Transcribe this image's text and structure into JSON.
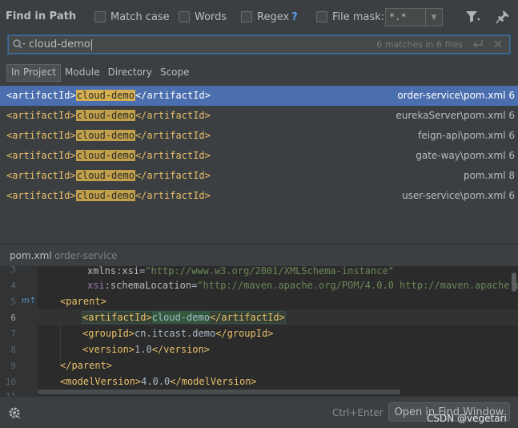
{
  "header": {
    "title": "Find in Path",
    "match_case_label": "Match case",
    "words_label": "Words",
    "regex_label": "Regex",
    "regex_help": "?",
    "file_mask_label": "File mask:",
    "file_mask_value": "*.*"
  },
  "search": {
    "query": "cloud-demo",
    "matches": "6 matches in 6 files"
  },
  "scopes": [
    "In Project",
    "Module",
    "Directory",
    "Scope"
  ],
  "results": [
    {
      "open": "<artifactId>",
      "match": "cloud-demo",
      "close": "</artifactId>",
      "path": "order-service\\pom.xml 6"
    },
    {
      "open": "<artifactId>",
      "match": "cloud-demo",
      "close": "</artifactId>",
      "path": "eurekaServer\\pom.xml 6"
    },
    {
      "open": "<artifactId>",
      "match": "cloud-demo",
      "close": "</artifactId>",
      "path": "feign-api\\pom.xml 6"
    },
    {
      "open": "<artifactId>",
      "match": "cloud-demo",
      "close": "</artifactId>",
      "path": "gate-way\\pom.xml 6"
    },
    {
      "open": "<artifactId>",
      "match": "cloud-demo",
      "close": "</artifactId>",
      "path": "pom.xml 8"
    },
    {
      "open": "<artifactId>",
      "match": "cloud-demo",
      "close": "</artifactId>",
      "path": "user-service\\pom.xml 6"
    }
  ],
  "preview": {
    "file": "pom.xml",
    "dir": "order-service",
    "line_numbers": [
      "3",
      "4",
      "5",
      "6",
      "7",
      "8",
      "9",
      "10",
      "11"
    ],
    "code": {
      "l3_attr": "xmlns:xsi",
      "l3_val": "\"http://www.w3.org/2001/XMLSchema-instance\"",
      "l4_ns": "xsi",
      "l4_attr": ":schemaLocation",
      "l4_val": "\"http://maven.apache.org/POM/4.0.0 http://maven.apache.org",
      "l5": "<parent>",
      "l6_open": "<artifactId>",
      "l6_match": "cloud-demo",
      "l6_close": "</artifactId>",
      "l7_open": "<groupId>",
      "l7_text": "cn.itcast.demo",
      "l7_close": "</groupId>",
      "l8_open": "<version>",
      "l8_text": "1.0",
      "l8_close": "</version>",
      "l9": "</parent>",
      "l10_open": "<modelVersion>",
      "l10_text": "4.0.0",
      "l10_close": "</modelVersion>"
    }
  },
  "footer": {
    "shortcut": "Ctrl+Enter",
    "open_button": "Open in Find Window",
    "watermark": "CSDN @vegetari"
  },
  "icons": [
    "search-icon",
    "filter-icon",
    "pin-icon",
    "clear-icon",
    "enter-icon",
    "gear-icon",
    "maven-modified-icon"
  ]
}
